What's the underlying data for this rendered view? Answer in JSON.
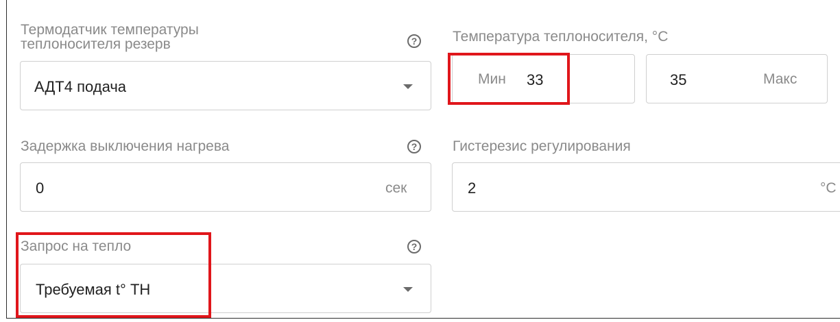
{
  "sensor_reserve": {
    "label_line1": "Термодатчик температуры",
    "label_line2": "теплоносителя резерв",
    "help": "?",
    "value": "АДТ4 подача"
  },
  "coolant_temp": {
    "label": "Температура теплоносителя, °C",
    "min_label": "Мин",
    "min_value": "33",
    "max_value": "35",
    "max_label": "Макс"
  },
  "heating_delay": {
    "label": "Задержка выключения нагрева",
    "help": "?",
    "value": "0",
    "unit": "сек"
  },
  "hysteresis": {
    "label": "Гистерезис регулирования",
    "value": "2",
    "unit": "°C"
  },
  "heat_request": {
    "label": "Запрос на тепло",
    "help": "?",
    "value": "Требуемая t° ТН"
  },
  "colors": {
    "highlight": "#e0161b",
    "label": "#8a8a8a",
    "border": "#cfcfcf"
  }
}
